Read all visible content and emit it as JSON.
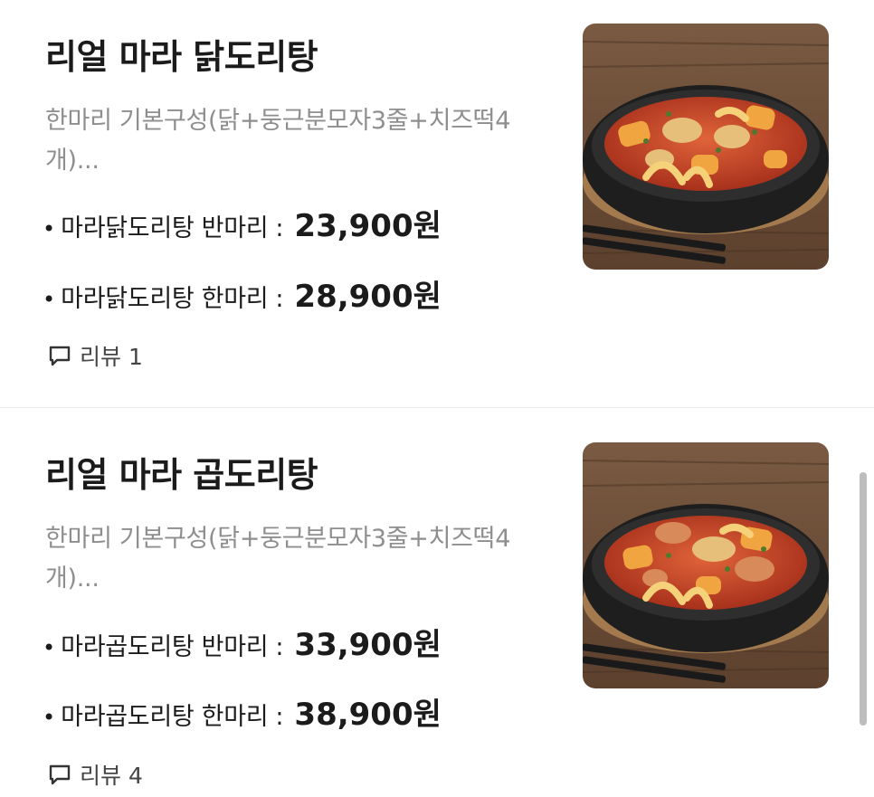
{
  "items": [
    {
      "title": "리얼 마라 닭도리탕",
      "description": "한마리 기본구성(닭+둥근분모자3줄+치즈떡4개)...",
      "prices": [
        {
          "label": "마라닭도리탕 반마리",
          "price": "23,900원"
        },
        {
          "label": "마라닭도리탕 한마리",
          "price": "28,900원"
        }
      ],
      "review": "리뷰 1",
      "image_icon": "mala-stew-dish-photo"
    },
    {
      "title": "리얼 마라 곱도리탕",
      "description": "한마리 기본구성(닭+둥근분모자3줄+치즈떡4개)...",
      "prices": [
        {
          "label": "마라곱도리탕 반마리",
          "price": "33,900원"
        },
        {
          "label": "마라곱도리탕 한마리",
          "price": "38,900원"
        }
      ],
      "review": "리뷰 4",
      "image_icon": "mala-stew-dish-photo"
    }
  ],
  "separator": ":",
  "bullet": "•",
  "colors": {
    "text": "#1b1b1b",
    "muted": "#8e8e8e",
    "divider": "#ececec",
    "sauce": "#c8452a",
    "bowl": "#2b2b2b"
  }
}
